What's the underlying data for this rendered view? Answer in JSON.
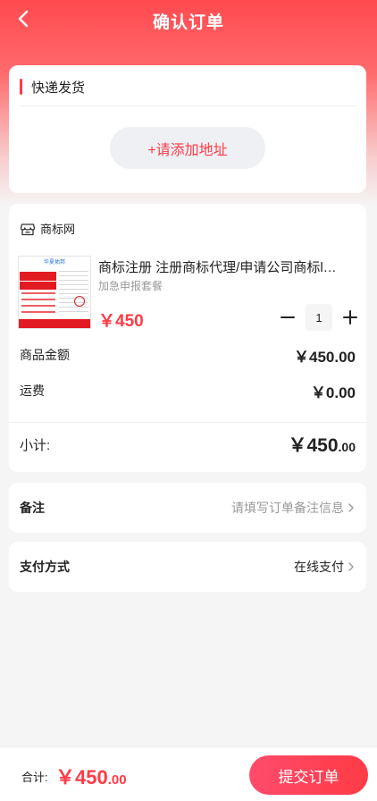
{
  "header": {
    "title": "确认订单"
  },
  "shipping": {
    "title": "快递发货",
    "add_address": "+请添加地址"
  },
  "order": {
    "shop_name": "商标网",
    "product": {
      "image": {
        "brand": "华夏佑邦",
        "headline1": "商标注册",
        "headline2": "LOGO设计",
        "footer": "拒绝注册  不过退款"
      },
      "title": "商标注册 注册商标代理/申请公司商标l…",
      "spec": "加急申报套餐",
      "price": "￥450",
      "quantity": "1"
    },
    "goods_amount_label": "商品金额",
    "goods_amount": "￥450.00",
    "shipping_fee_label": "运费",
    "shipping_fee": "￥0.00",
    "subtotal_label": "小计:",
    "subtotal_main": "￥450",
    "subtotal_decimal": ".00"
  },
  "remark": {
    "label": "备注",
    "placeholder": "请填写订单备注信息"
  },
  "payment": {
    "label": "支付方式",
    "value": "在线支付"
  },
  "footer": {
    "total_label": "合计:",
    "total_main": "￥450",
    "total_decimal": ".00",
    "submit_label": "提交订单"
  },
  "colors": {
    "accent": "#ff3b46",
    "header_gradient_top": "#ff4a4f",
    "background": "#f5f5f5"
  }
}
